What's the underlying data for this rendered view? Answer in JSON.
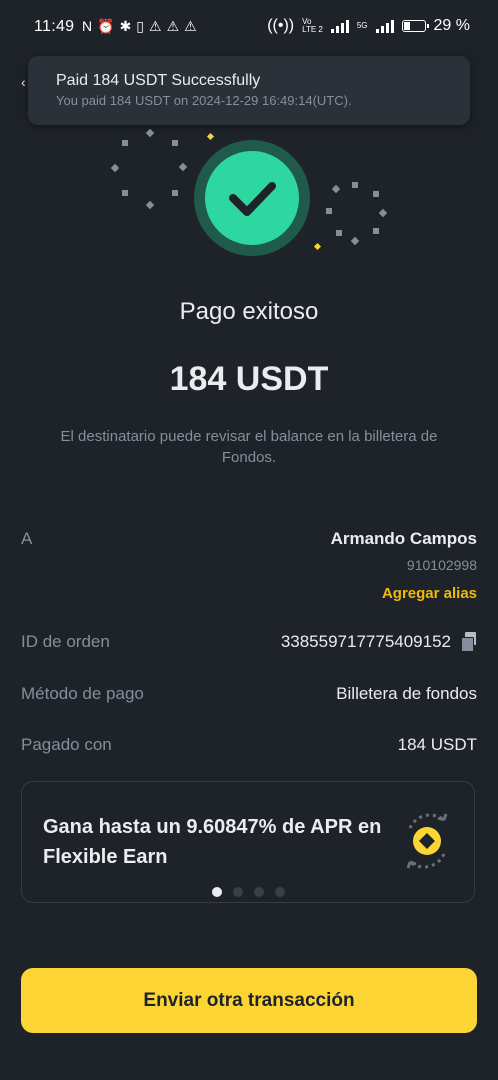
{
  "status_bar": {
    "time": "11:49",
    "left_icons": [
      "N",
      "⏰",
      "✱",
      "▯",
      "⚠",
      "⚠",
      "⚠"
    ],
    "net1": "Vo",
    "net2": "LTE 2",
    "net3": "5G",
    "battery": "29 %",
    "battery_level": 0.29
  },
  "toast": {
    "title": "Paid 184 USDT Successfully",
    "subtitle": "You paid 184 USDT on 2024-12-29 16:49:14(UTC)."
  },
  "result": {
    "title": "Pago exitoso",
    "amount": "184 USDT",
    "note": "El destinatario puede revisar el balance en la billetera de Fondos.",
    "accent_color": "#2ed6a0"
  },
  "details": {
    "to_label": "A",
    "to_name": "Armando Campos",
    "to_account": "910102998",
    "alias_link": "Agregar alias",
    "order_label": "ID de orden",
    "order_id": "338559717775409152",
    "method_label": "Método de pago",
    "method_value": "Billetera de fondos",
    "paid_label": "Pagado con",
    "paid_value": "184 USDT"
  },
  "promo": {
    "text": "Gana hasta un 9.60847% de APR en Flexible Earn",
    "icon": "flexible-earn-coin-icon",
    "pages": 4,
    "active_page": 1
  },
  "cta": {
    "label": "Enviar otra transacción",
    "color": "#fcd535"
  }
}
